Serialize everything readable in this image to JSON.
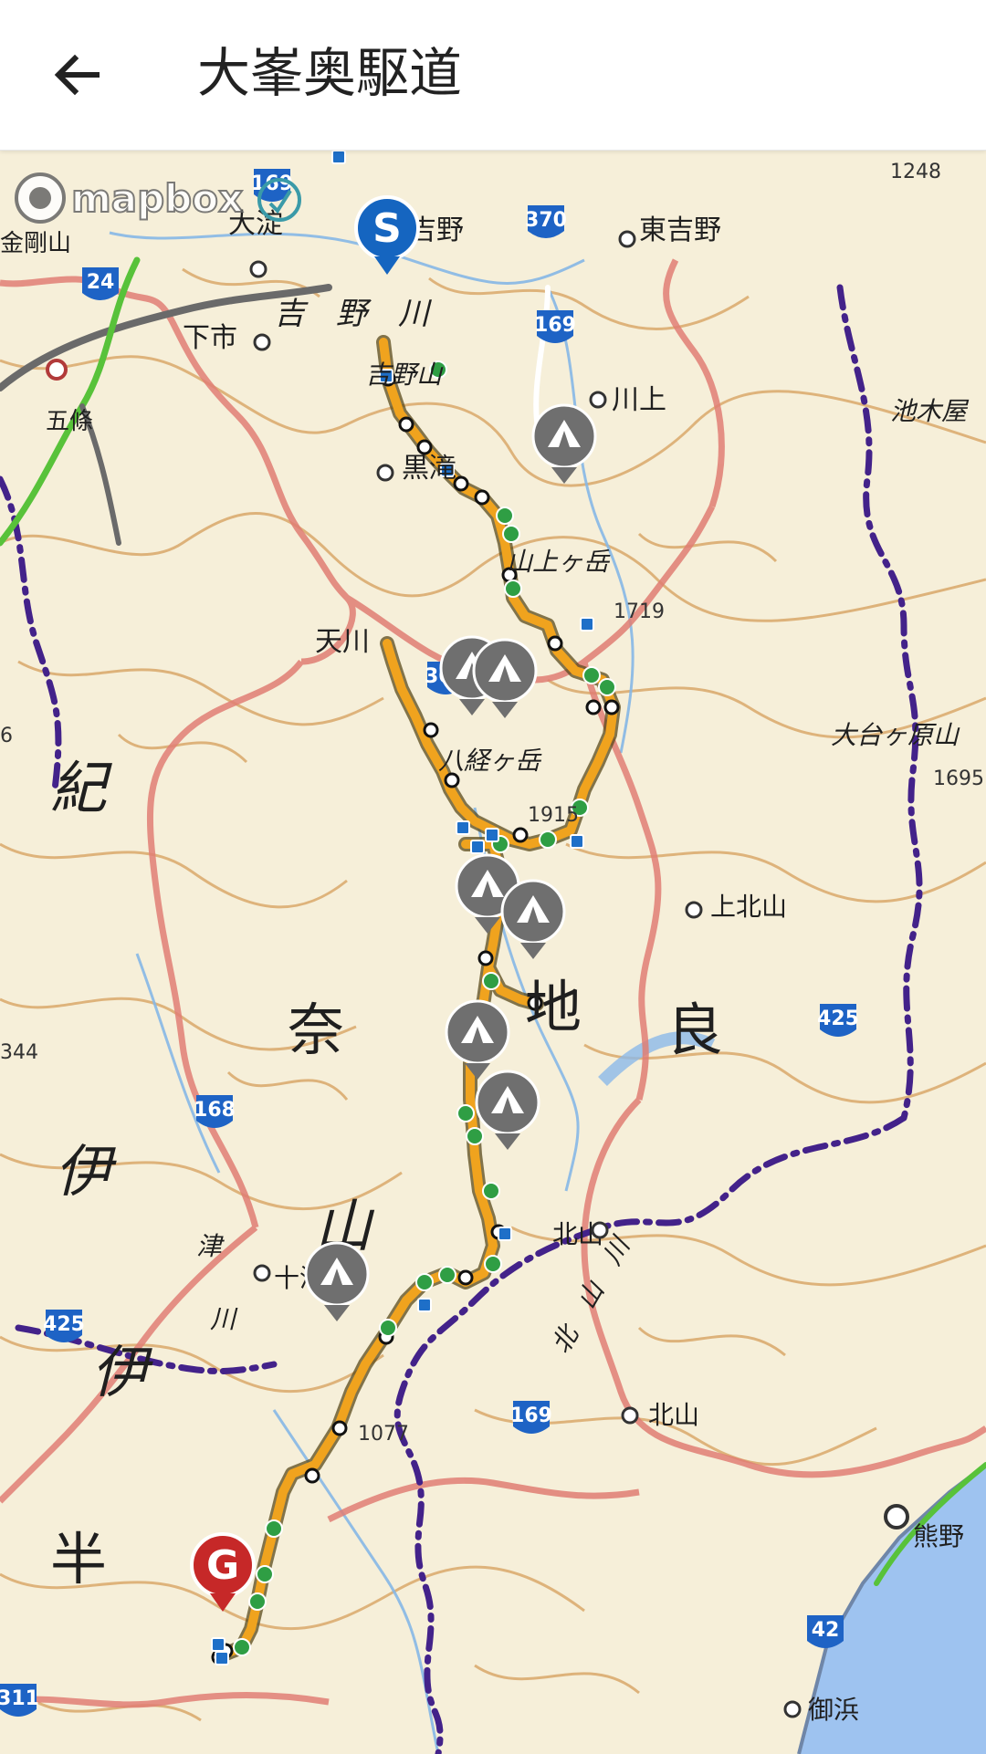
{
  "header": {
    "title": "大峯奥駆道",
    "back_icon": "arrow-left-icon"
  },
  "map": {
    "attribution": "mapbox",
    "start_marker": "S",
    "goal_marker": "G",
    "colors": {
      "route": "#f0a31e",
      "route_outline": "#5a4a1a",
      "start": "#1565c0",
      "goal": "#c62828",
      "camp": "#6f6f6f",
      "sea": "#9ec3f0",
      "contour": "#d9a86a",
      "boundary": "#e07e74",
      "pref_border": "#43228a"
    },
    "places": {
      "oyodo": "大淀",
      "yoshino_town": "吉野",
      "higashiyoshino": "東吉野",
      "shimoichi": "下市",
      "yoshino_river": "吉　野　川",
      "yoshinoyama": "吉野山",
      "kawakami": "川上",
      "kurotaki": "黒滝",
      "sanjogatake": "山上ヶ岳",
      "tenkawa": "天川",
      "misengatake": "八経ヶ岳",
      "odaigahara": "大台ヶ原山",
      "kamikitayama": "上北山",
      "kii": "紀",
      "nara": "奈",
      "yama": "山",
      "chi": "地",
      "ryo": "良",
      "i1": "伊",
      "i2": "伊",
      "han": "半",
      "totsukawa": "十津川",
      "kitayama": "北山",
      "kitayama2": "北山",
      "kumano": "熊野",
      "mihama": "御浜",
      "ikeki": "池木屋",
      "gojo": "五條",
      "kongo": "金剛山",
      "tsu": "津",
      "kawa": "川",
      "kitayama_river": "北　山　川"
    },
    "elevations": {
      "e1248": "1248",
      "e1719": "1719",
      "e1915": "1915",
      "e1695": "1695",
      "e1077": "1077",
      "e344": "344",
      "e6": "6"
    },
    "routes": {
      "r169a": "169",
      "r169b": "169",
      "r169c": "169",
      "r370": "370",
      "r24": "24",
      "r309": "309",
      "r168": "168",
      "r425a": "425",
      "r425b": "425",
      "r42": "42",
      "r311": "311"
    }
  }
}
